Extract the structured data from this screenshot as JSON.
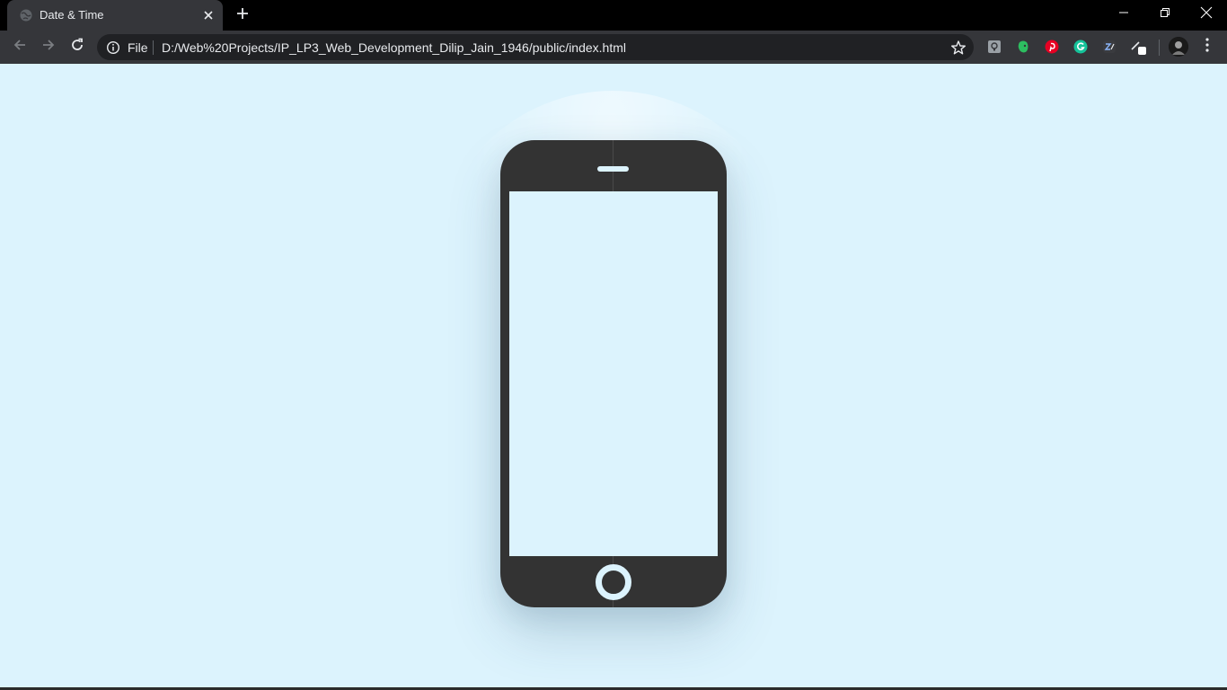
{
  "browser": {
    "tab": {
      "title": "Date & Time",
      "favicon": "globe-icon",
      "close_icon": "close-icon"
    },
    "new_tab_icon": "plus-icon",
    "window_controls": [
      "minimize-icon",
      "restore-icon",
      "close-icon"
    ],
    "nav": {
      "back_icon": "arrow-left-icon",
      "forward_icon": "arrow-right-icon",
      "reload_icon": "reload-icon"
    },
    "omnibox": {
      "info_icon": "info-icon",
      "scheme_label": "File",
      "url": "D:/Web%20Projects/IP_LP3_Web_Development_Dilip_Jain_1946/public/index.html",
      "bookmark_icon": "star-icon"
    },
    "extensions": [
      "lightbulb-extension-icon",
      "evernote-icon",
      "pinterest-icon",
      "grammarly-icon",
      "zoom-extension-icon",
      "pen-extension-icon"
    ],
    "profile_icon": "avatar",
    "menu_icon": "kebab-menu-icon"
  },
  "page": {
    "background_color": "#dcf3fd",
    "phone_color": "#333333"
  }
}
